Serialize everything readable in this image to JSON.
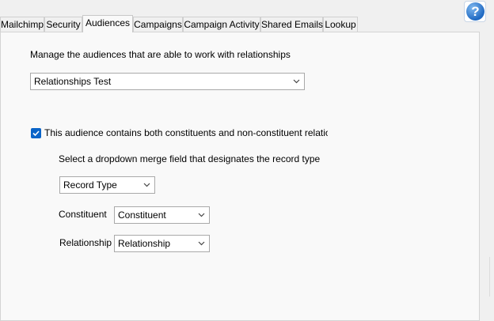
{
  "tabs": [
    {
      "label": "Mailchimp"
    },
    {
      "label": "Security"
    },
    {
      "label": "Audiences"
    },
    {
      "label": "Campaigns"
    },
    {
      "label": "Campaign Activity"
    },
    {
      "label": "Shared Emails"
    },
    {
      "label": "Lookup"
    }
  ],
  "help": {
    "glyph": "?"
  },
  "audiences": {
    "instruction": "Manage the audiences that are able to work with relationships",
    "audience_select": {
      "value": "Relationships Test"
    },
    "mixed_checkbox": {
      "checked": true,
      "label": "This audience contains both constituents and non-constituent relationshi"
    },
    "merge_instruction": "Select a dropdown merge field that designates the record type",
    "merge_field_select": {
      "value": "Record Type"
    },
    "constituent": {
      "label": "Constituent",
      "value": "Constituent"
    },
    "relationship": {
      "label": "Relationship",
      "value": "Relationship"
    }
  },
  "colors": {
    "accent": "#0a64c8",
    "panel": "#f9f9f9",
    "window": "#f0f0f0"
  }
}
